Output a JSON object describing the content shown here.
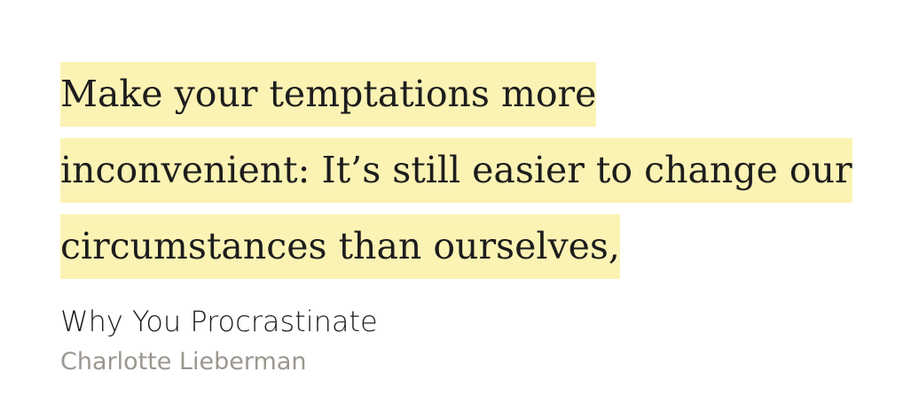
{
  "quote": {
    "lines": [
      "Make your temptations more",
      "inconvenient: It’s still easier to change our",
      "circumstances than ourselves,"
    ]
  },
  "source": {
    "title": "Why You Procrastinate",
    "author": "Charlotte Lieberman"
  },
  "colors": {
    "highlight": "#fbf3b4",
    "text": "#1d1d1d",
    "author": "#9b968f",
    "background": "#ffffff"
  }
}
